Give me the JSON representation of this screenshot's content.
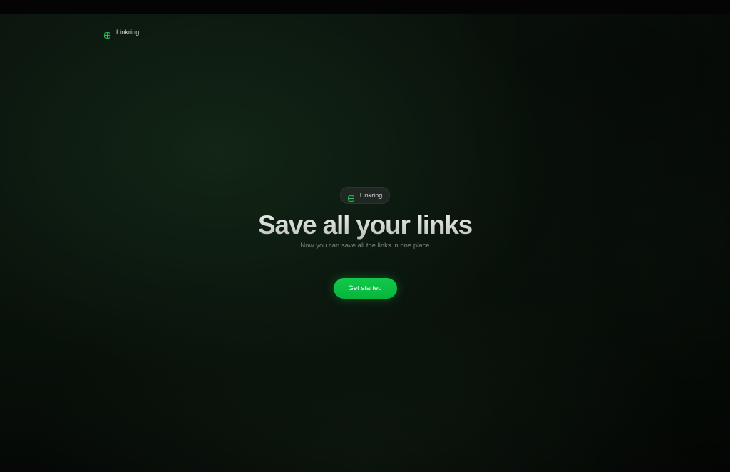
{
  "header": {
    "brand_name": "Linkring",
    "brand_icon": "link-ring-icon"
  },
  "hero": {
    "badge_label": "Linkring",
    "badge_icon": "link-ring-icon",
    "title": "Save all your links",
    "subtitle": "Now you can save all the links in one place",
    "cta_label": "Get started"
  },
  "colors": {
    "accent": "#0cc143",
    "background": "#0d170f",
    "icon": "#25c35a"
  }
}
